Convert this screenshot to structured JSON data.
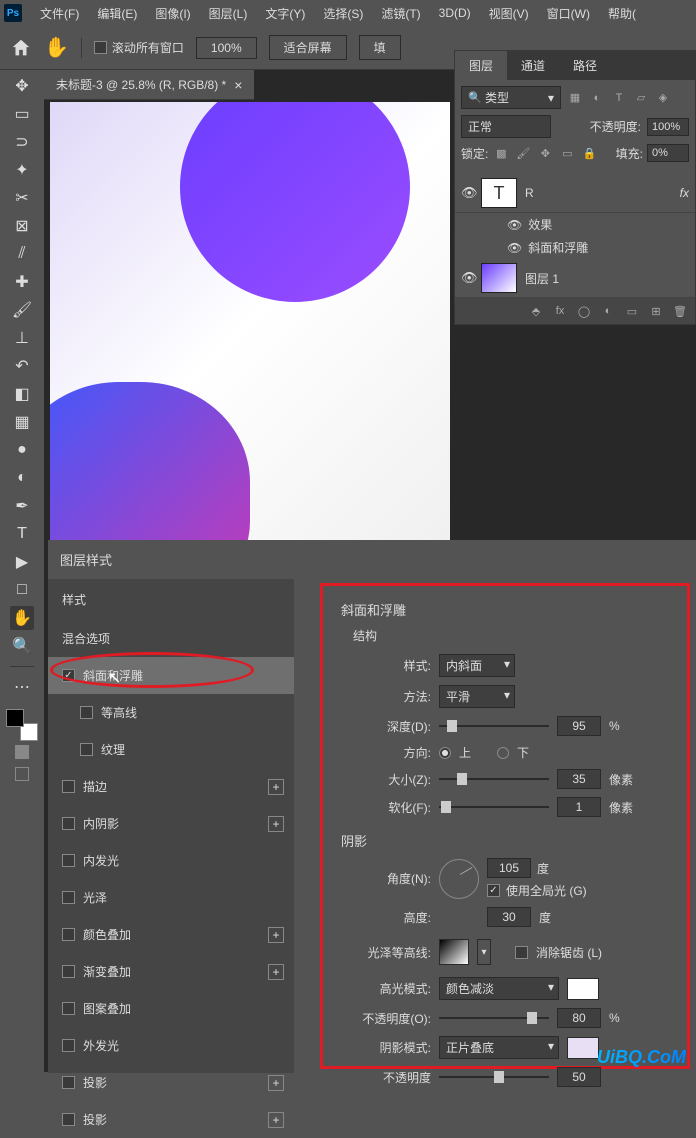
{
  "menu": [
    "文件(F)",
    "编辑(E)",
    "图像(I)",
    "图层(L)",
    "文字(Y)",
    "选择(S)",
    "滤镜(T)",
    "3D(D)",
    "视图(V)",
    "窗口(W)",
    "帮助("
  ],
  "options": {
    "scroll_all": "滚动所有窗口",
    "zoom": "100%",
    "fit": "适合屏幕",
    "fill_btn": "填"
  },
  "doc_tab": "未标题-3 @ 25.8% (R, RGB/8) *",
  "layers_panel": {
    "tabs": [
      "图层",
      "通道",
      "路径"
    ],
    "type_search": "类型",
    "blend": "正常",
    "opacity_label": "不透明度:",
    "opacity_val": "100%",
    "lock_label": "锁定:",
    "fill_label": "填充:",
    "fill_val": "0%",
    "layer_r": "R",
    "fx": "fx",
    "effects": "效果",
    "bevel_fx": "斜面和浮雕",
    "layer1": "图层 1"
  },
  "dialog": {
    "title": "图层样式",
    "styles_hdr": "样式",
    "blend_opts": "混合选项",
    "items": {
      "bevel": "斜面和浮雕",
      "contour": "等高线",
      "texture": "纹理",
      "stroke": "描边",
      "inner_shadow": "内阴影",
      "inner_glow": "内发光",
      "satin": "光泽",
      "color_overlay": "颜色叠加",
      "grad_overlay": "渐变叠加",
      "pattern_overlay": "图案叠加",
      "outer_glow": "外发光",
      "drop_shadow1": "投影",
      "drop_shadow2": "投影"
    }
  },
  "bevel": {
    "title": "斜面和浮雕",
    "structure": "结构",
    "style_label": "样式:",
    "style_val": "内斜面",
    "technique_label": "方法:",
    "technique_val": "平滑",
    "depth_label": "深度(D):",
    "depth_val": "95",
    "depth_unit": "%",
    "direction_label": "方向:",
    "dir_up": "上",
    "dir_down": "下",
    "size_label": "大小(Z):",
    "size_val": "35",
    "size_unit": "像素",
    "soften_label": "软化(F):",
    "soften_val": "1",
    "soften_unit": "像素",
    "shading": "阴影",
    "angle_label": "角度(N):",
    "angle_val": "105",
    "angle_unit": "度",
    "global_light": "使用全局光 (G)",
    "altitude_label": "高度:",
    "altitude_val": "30",
    "altitude_unit": "度",
    "gloss_label": "光泽等高线:",
    "antialias": "消除锯齿 (L)",
    "highlight_mode_label": "高光模式:",
    "highlight_mode_val": "颜色减淡",
    "highlight_opacity_label": "不透明度(O):",
    "highlight_opacity_val": "80",
    "highlight_opacity_unit": "%",
    "shadow_mode_label": "阴影模式:",
    "shadow_mode_val": "正片叠底",
    "shadow_opacity_label": "不透明度",
    "shadow_opacity_val": "50"
  },
  "watermark": "UiBQ.CoM"
}
